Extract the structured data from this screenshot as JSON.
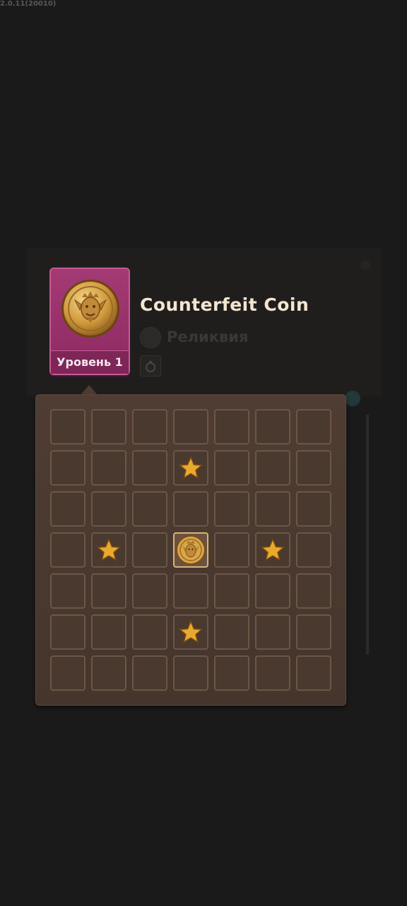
{
  "app": {
    "version": "2.0.11(20010)"
  },
  "item": {
    "name": "Counterfeit Coin",
    "level_label": "Уровень 1",
    "type_label": "Реликвия",
    "type_icon": "coin-outline-icon",
    "slot_icon": "ring-icon",
    "card_color": "#a43a74"
  },
  "grid": {
    "rows": 7,
    "cols": 7,
    "center": {
      "row": 4,
      "col": 4,
      "icon": "counterfeit-coin-icon"
    },
    "star_cells": [
      {
        "row": 2,
        "col": 4
      },
      {
        "row": 4,
        "col": 2
      },
      {
        "row": 4,
        "col": 6
      },
      {
        "row": 6,
        "col": 4
      }
    ],
    "star_color": "#e8a92f"
  }
}
